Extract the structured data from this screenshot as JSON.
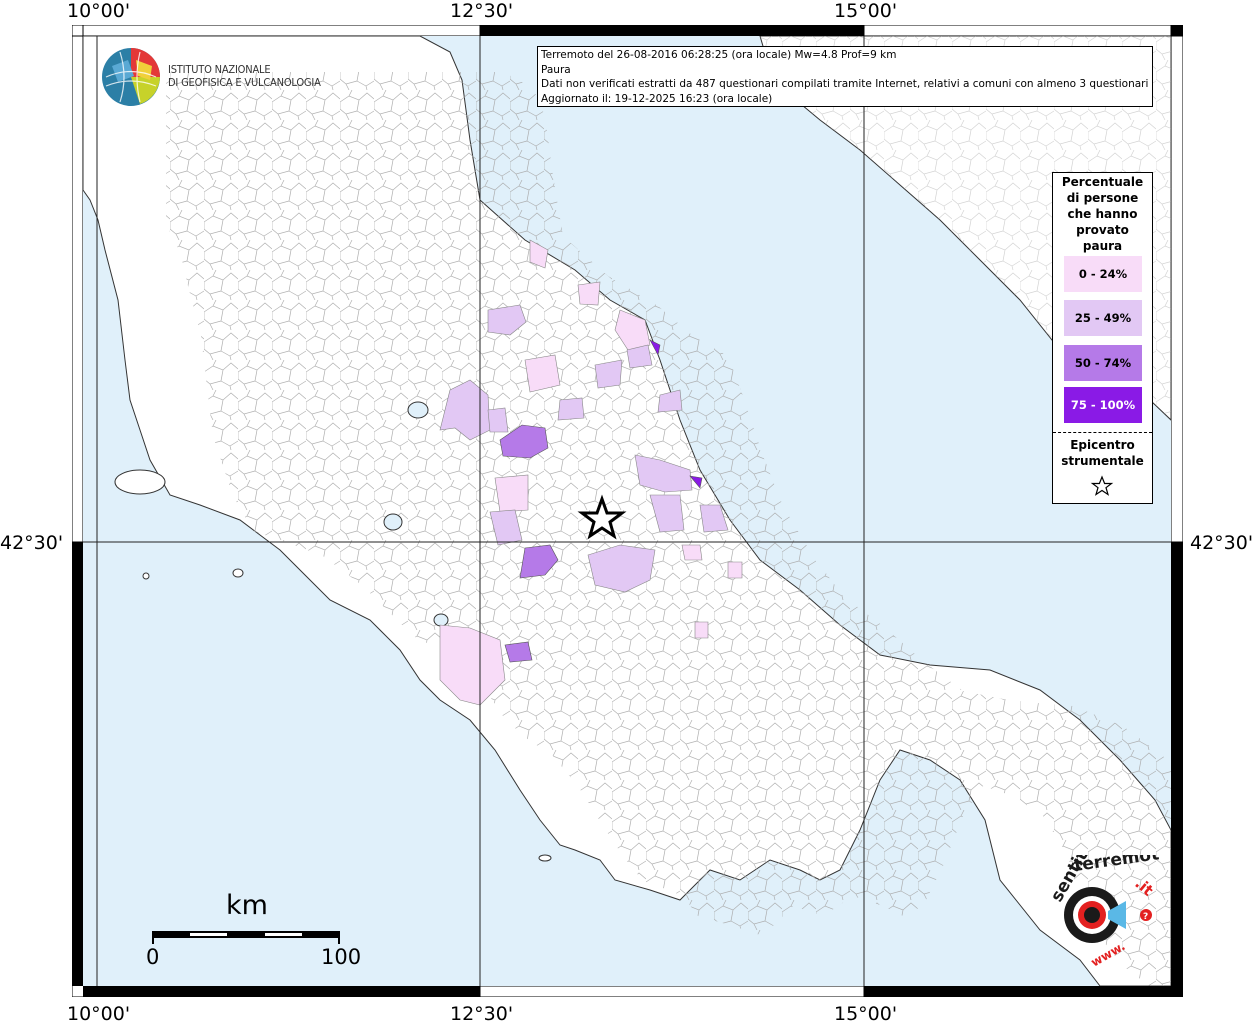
{
  "coords": {
    "top": [
      "10°00'",
      "12°30'",
      "15°00'"
    ],
    "bottom": [
      "10°00'",
      "12°30'",
      "15°00'"
    ],
    "left_lat": "42°30'",
    "right_lat": "42°30'"
  },
  "info": {
    "line1": "Terremoto del 26-08-2016 06:28:25 (ora locale) Mw=4.8 Prof=9 km",
    "line2": "Paura",
    "line3": "Dati non verificati estratti da 487 questionari compilati tramite Internet, relativi a comuni con almeno 3 questionari.",
    "line4": "Aggiornato il: 19-12-2025 16:23 (ora locale)"
  },
  "logo": {
    "line1": "ISTITUTO NAZIONALE",
    "line2": "DI GEOFISICA E VULCANOLOGIA"
  },
  "legend": {
    "title": [
      "Percentuale",
      "di persone",
      "che hanno",
      "provato",
      "paura"
    ],
    "classes": [
      {
        "label": "0 - 24%",
        "color": "#f8dcf8",
        "text_color": "#000000"
      },
      {
        "label": "25 - 49%",
        "color": "#e2c8f4",
        "text_color": "#000000"
      },
      {
        "label": "50 - 74%",
        "color": "#b57ae8",
        "text_color": "#000000"
      },
      {
        "label": "75 - 100%",
        "color": "#8a1ae6",
        "text_color": "#ffffff"
      }
    ],
    "epicenter_line1": "Epicentro",
    "epicenter_line2": "strumentale",
    "epicenter_icon": "star-icon"
  },
  "scale": {
    "unit": "km",
    "start": "0",
    "end": "100"
  },
  "brand": {
    "word1": "haisentito",
    "word2": "ilterremoto",
    "word3": ".it",
    "url": "www."
  },
  "colors": {
    "sea": "#e0f0fa",
    "land": "#ffffff",
    "borders": "#9a9a9a"
  }
}
